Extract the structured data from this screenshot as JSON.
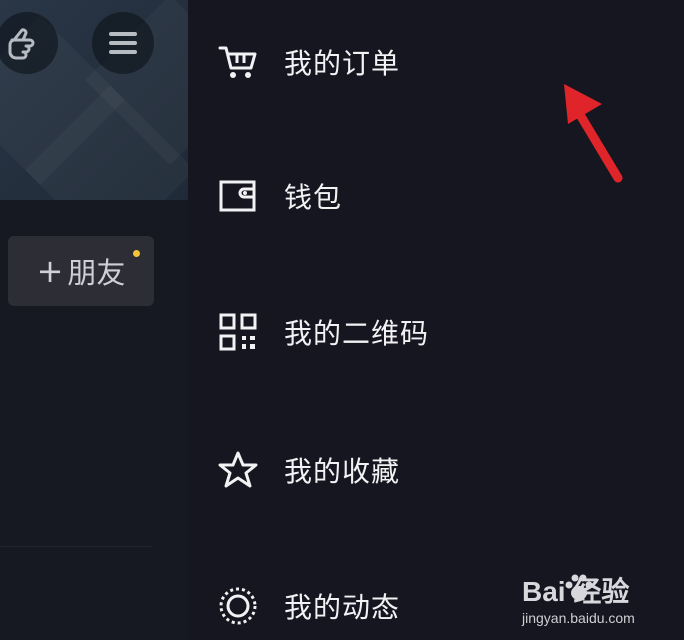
{
  "left_panel": {
    "add_friend": {
      "plus": "+",
      "label": "朋友"
    }
  },
  "drawer": {
    "items": [
      {
        "label": "我的订单",
        "icon": "cart-icon"
      },
      {
        "label": "钱包",
        "icon": "wallet-icon"
      },
      {
        "label": "我的二维码",
        "icon": "qr-code-icon"
      },
      {
        "label": "我的收藏",
        "icon": "star-icon"
      },
      {
        "label": "我的动态",
        "icon": "activity-ring-icon"
      }
    ]
  },
  "annotation": {
    "color": "#e0252a"
  },
  "watermark": {
    "brand": "Bai  经验",
    "url": "jingyan.baidu.com"
  },
  "colors": {
    "background": "#15161f",
    "text": "#f2f2f4",
    "badge": "#f4c537"
  }
}
